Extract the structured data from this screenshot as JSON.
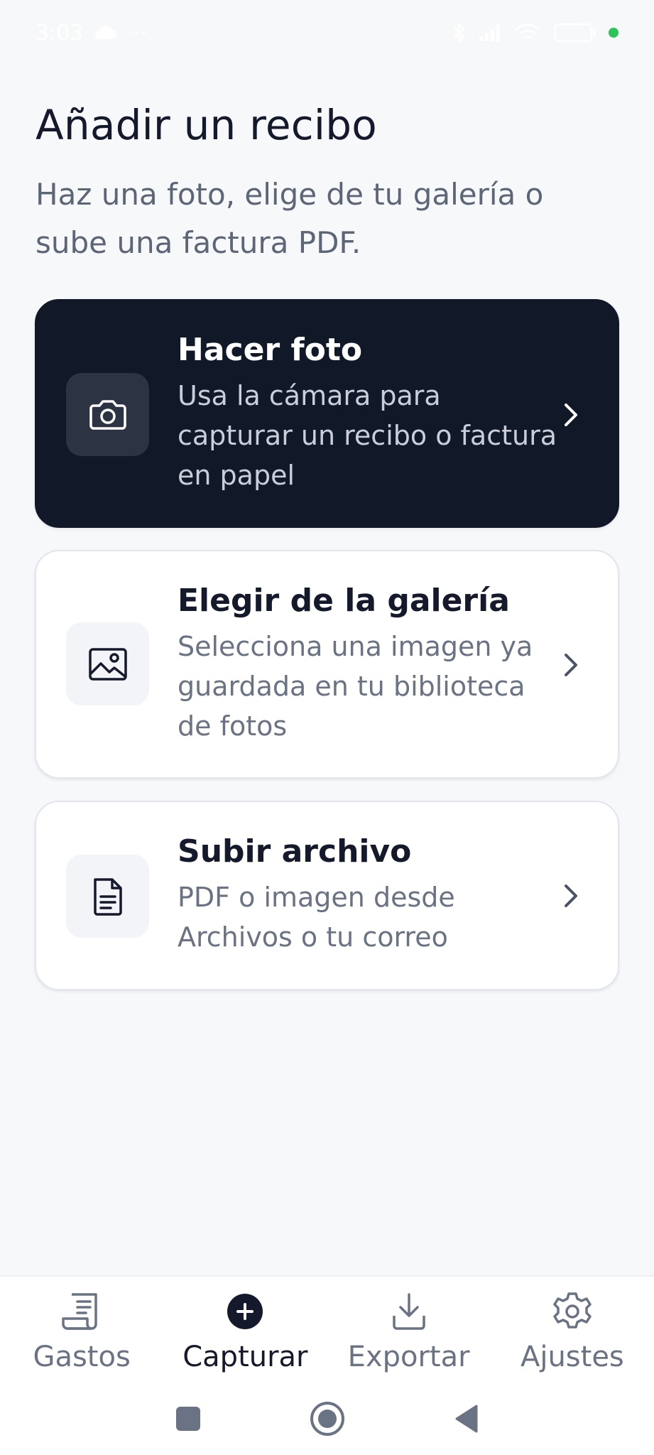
{
  "status_bar": {
    "time": "3:03",
    "more": "···"
  },
  "header": {
    "title": "Añadir un recibo",
    "subtitle": "Haz una foto, elige de tu galería o sube una factura PDF."
  },
  "options": [
    {
      "icon": "camera-icon",
      "title": "Hacer foto",
      "description": "Usa la cámara para capturar un recibo o factura en papel"
    },
    {
      "icon": "image-icon",
      "title": "Elegir de la galería",
      "description": "Selecciona una imagen ya guardada en tu biblioteca de fotos"
    },
    {
      "icon": "document-icon",
      "title": "Subir archivo",
      "description": "PDF o imagen desde Archivos o tu correo"
    }
  ],
  "bottom_nav": [
    {
      "icon": "receipt-icon",
      "label": "Gastos"
    },
    {
      "icon": "plus-circle-icon",
      "label": "Capturar",
      "active": true
    },
    {
      "icon": "download-icon",
      "label": "Exportar"
    },
    {
      "icon": "gear-icon",
      "label": "Ajustes"
    }
  ],
  "colors": {
    "background": "#f7f8fa",
    "primary_card": "#111827",
    "text_dark": "#141a2b",
    "text_muted": "#6a7383",
    "status_dot": "#2bc35a"
  }
}
